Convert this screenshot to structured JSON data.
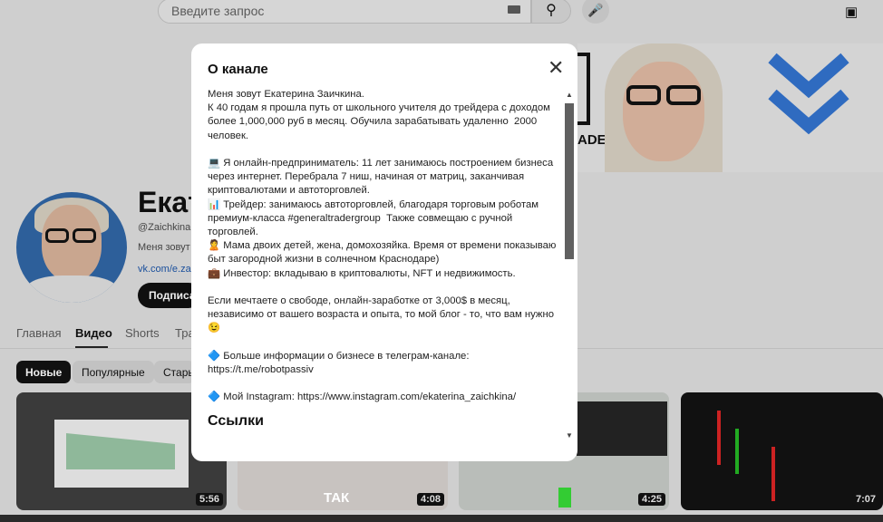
{
  "header": {
    "search_placeholder": "Введите запрос"
  },
  "banner": {
    "text": "ADER"
  },
  "channel": {
    "name": "Екат",
    "handle": "@ZaichkinaE",
    "description": "Меня зовут",
    "link": "vk.com/e.za",
    "subscribe": "Подписат"
  },
  "tabs": [
    "Главная",
    "Видео",
    "Shorts",
    "Тра"
  ],
  "chips": [
    "Новые",
    "Популярные",
    "Стары"
  ],
  "videos": [
    {
      "duration": "5:56"
    },
    {
      "duration": "4:08",
      "overlay": "ТАК"
    },
    {
      "duration": "4:25"
    },
    {
      "duration": "7:07"
    }
  ],
  "modal": {
    "title": "О канале",
    "paragraphs": [
      "Меня зовут Екатерина Заичкина.\nК 40 годам я прошла путь от школьного учителя до трейдера с доходом более 1,000,000 руб в месяц. Обучила зарабатывать удаленно  2000 человек.",
      "💻 Я онлайн-предприниматель: 11 лет занимаюсь построением бизнеса через интернет. Перебрала 7 ниш, начиная от матриц, заканчивая криптовалютами и автоторговлей.\n📊 Трейдер: занимаюсь автоторговлей, благодаря торговым роботам премиум-класса #generaltradergroup  Также совмещаю с ручной торговлей.\n🙎 Мама двоих детей, жена, домохозяйка. Время от времени показываю быт загородной жизни в солнечном Краснодаре)\n💼 Инвестор: вкладываю в криптовалюты, NFT и недвижимость.",
      "Если мечтаете о свободе, онлайн-заработке от 3,000$ в месяц, независимо от вашего возраста и опыта, то мой блог - то, что вам нужно\n😉",
      "🔷 Больше информации о бизнесе в телеграм-канале:\nhttps://t.me/robotpassiv",
      "🔷 Мой Instagram: https://www.instagram.com/ekaterina_zaichkina/"
    ],
    "links_heading": "Ссылки"
  }
}
